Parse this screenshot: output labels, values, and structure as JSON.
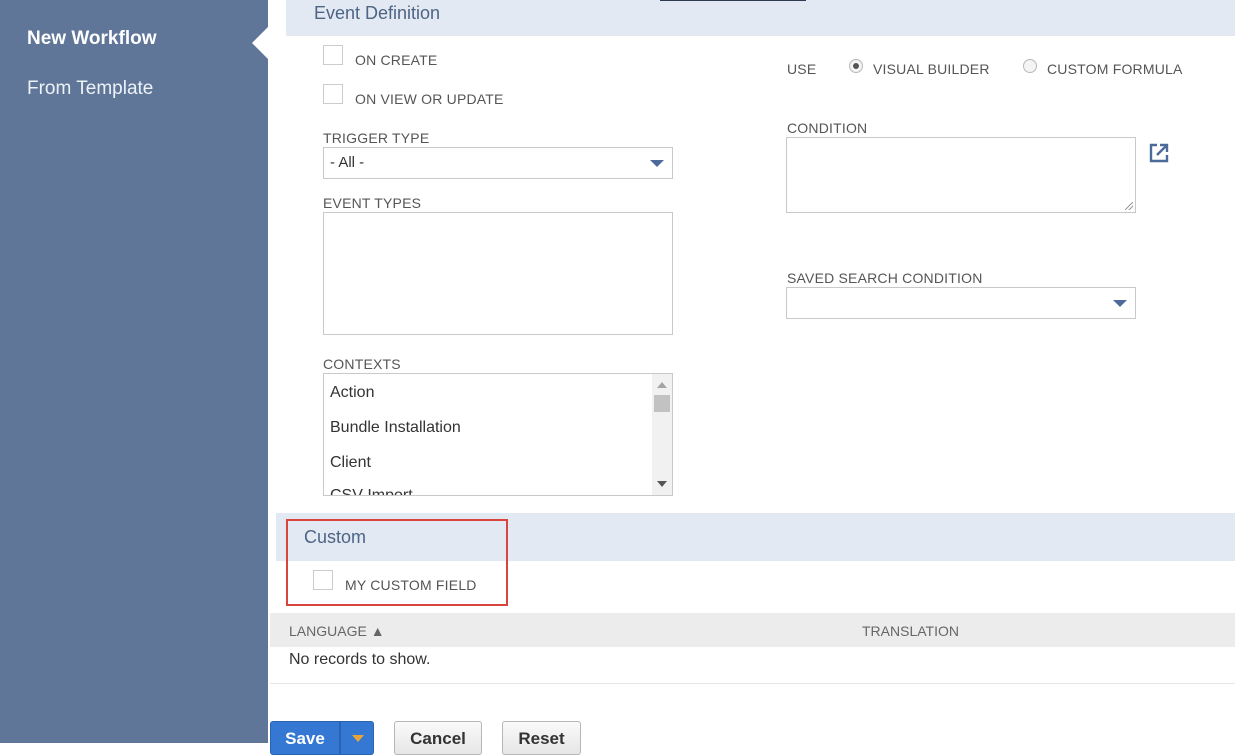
{
  "sidebar": {
    "items": [
      {
        "label": "New Workflow"
      },
      {
        "label": "From Template"
      }
    ]
  },
  "event_definition": {
    "header": "Event Definition",
    "on_create_label": "ON CREATE",
    "on_view_update_label": "ON VIEW OR UPDATE",
    "trigger_type_label": "TRIGGER TYPE",
    "trigger_type_value": "- All -",
    "event_types_label": "EVENT TYPES",
    "contexts_label": "CONTEXTS",
    "contexts": [
      "Action",
      "Bundle Installation",
      "Client",
      "CSV Import"
    ],
    "use_label": "USE",
    "visual_builder_label": "VISUAL BUILDER",
    "custom_formula_label": "CUSTOM FORMULA",
    "condition_label": "CONDITION",
    "saved_search_label": "SAVED SEARCH CONDITION"
  },
  "custom": {
    "header": "Custom",
    "my_custom_field_label": "MY CUSTOM FIELD"
  },
  "translations": {
    "col_language": "LANGUAGE ▲",
    "col_translation": "TRANSLATION",
    "empty": "No records to show."
  },
  "buttons": {
    "save": "Save",
    "cancel": "Cancel",
    "reset": "Reset"
  },
  "colors": {
    "sidebar": "#5f7698",
    "section_header": "#e3e9f2",
    "primary": "#3478d4",
    "highlight": "#d9453d"
  }
}
